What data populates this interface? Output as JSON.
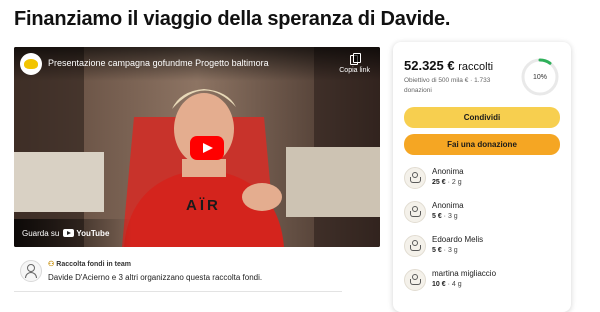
{
  "page": {
    "title": "Finanziamo il viaggio della speranza di Davide."
  },
  "video": {
    "title": "Presentazione campagna gofundme Progetto baltimora",
    "copy_link_label": "Copia link",
    "watch_on_label": "Guarda su",
    "youtube_label": "YouTube",
    "shirt_text": "AÏR"
  },
  "organizer": {
    "badge": "Raccolta fondi in team",
    "text": "Davide D'Acierno e 3 altri organizzano questa raccolta fondi."
  },
  "sidebar": {
    "raised_amount": "52.325 €",
    "raised_suffix": "raccolti",
    "goal_text": "Obiettivo di 500 mila € · 1.733 donazioni",
    "progress_label": "10%",
    "progress_fraction": 0.1,
    "share_label": "Condividi",
    "donate_label": "Fai una donazione",
    "donations": [
      {
        "name": "Anonima",
        "amount": "25 €",
        "time": "2 g"
      },
      {
        "name": "Anonima",
        "amount": "5 €",
        "time": "3 g"
      },
      {
        "name": "Edoardo Melis",
        "amount": "5 €",
        "time": "3 g"
      },
      {
        "name": "martina migliaccio",
        "amount": "10 €",
        "time": "4 g"
      }
    ]
  },
  "colors": {
    "share_button": "#f7cf4f",
    "donate_button": "#f5a623",
    "progress_green": "#2fb05a",
    "play_red": "#ff0000"
  },
  "icons": {
    "copy_link": "copy-icon",
    "play": "play-icon",
    "organizer": "user-icon",
    "team": "team-icon",
    "donor": "donor-hand-icon"
  }
}
